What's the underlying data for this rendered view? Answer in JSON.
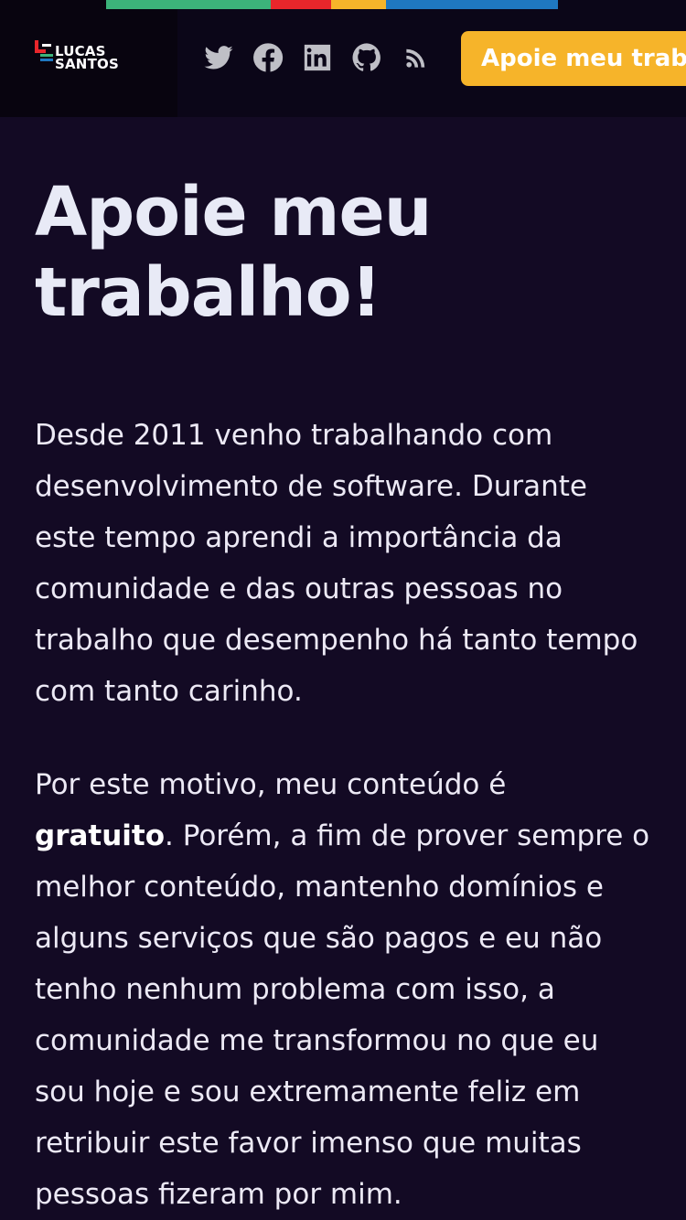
{
  "colors": {
    "background": "#130a24",
    "header_bg": "#0b0618",
    "accent_button": "#f6b42a",
    "strip": [
      "#3cb37a",
      "#e8262b",
      "#f6b42a",
      "#1f78c1"
    ]
  },
  "header": {
    "logo": {
      "line1": "LUCAS",
      "line2": "SANTOS"
    },
    "social": [
      {
        "name": "twitter-icon"
      },
      {
        "name": "facebook-icon"
      },
      {
        "name": "linkedin-icon"
      },
      {
        "name": "github-icon"
      },
      {
        "name": "rss-icon"
      }
    ],
    "support_button": "Apoie meu trabalho"
  },
  "main": {
    "title": "Apoie meu trabalho!",
    "paragraph1": "Desde 2011 venho trabalhando com desenvolvimento de software. Durante este tempo aprendi a importância da comunidade e das outras pessoas no trabalho que desempenho há tanto tempo com tanto carinho.",
    "paragraph2_start": "Por este motivo, meu conteúdo é ",
    "paragraph2_bold": "gratuito",
    "paragraph2_end": ". Porém, a fim de prover sempre o melhor conteúdo, mantenho domínios e alguns serviços que são pagos e eu não tenho nenhum problema com isso, a comunidade me transformou no que eu sou hoje e sou extremamente feliz em retribuir este favor imenso que muitas pessoas fizeram por mim."
  }
}
